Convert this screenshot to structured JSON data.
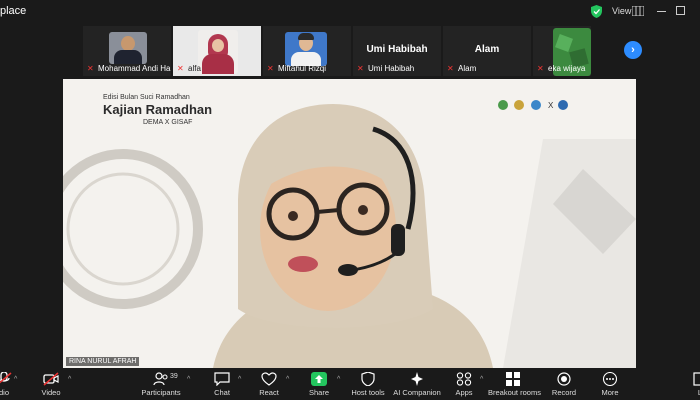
{
  "window": {
    "title": "place"
  },
  "topbar": {
    "view_label": "View"
  },
  "thumbnails": [
    {
      "name": "Mohammad Andi Ha...",
      "muted": true
    },
    {
      "name": "alfa",
      "muted": true
    },
    {
      "name": "Miftahul Rizqi",
      "muted": true
    },
    {
      "name": "Umi Habibah",
      "muted": true,
      "display_name": "Umi Habibah"
    },
    {
      "name": "Alam",
      "muted": true,
      "display_name": "Alam"
    },
    {
      "name": "eka wijaya",
      "muted": true
    }
  ],
  "main_video": {
    "banner_sub": "Edisi Bulan Suci Ramadhan",
    "banner_title": "Kajian Ramadhan",
    "banner_sub2": "DEMA X GISAF",
    "sponsor_separator": "X",
    "speaker_name": "RINA NURUL AFRAH"
  },
  "toolbar": {
    "audio_label": "dio",
    "video_label": "Video",
    "participants_label": "Participants",
    "participants_count": "39",
    "chat_label": "Chat",
    "react_label": "React",
    "share_label": "Share",
    "host_tools_label": "Host tools",
    "ai_companion_label": "AI Companion",
    "apps_label": "Apps",
    "breakout_label": "Breakout rooms",
    "record_label": "Record",
    "more_label": "More",
    "leave_label": "L"
  },
  "colors": {
    "accent": "#2d8cff",
    "share_green": "#23c55e",
    "muted_red": "#e33333",
    "background": "#1a1a1a"
  }
}
